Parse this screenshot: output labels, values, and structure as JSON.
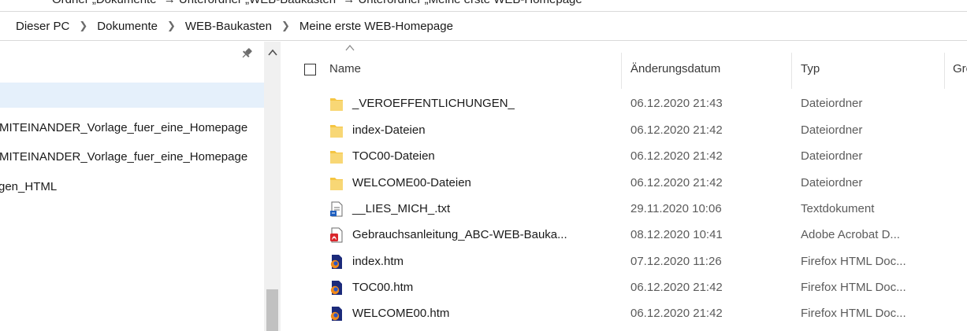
{
  "top_strip": {
    "text": "Ordner „Dokumente“ → Unterordner „WEB-Baukasten“ → Unterordner „Meine erste WEB-Homepage“"
  },
  "breadcrumb": [
    "Dieser PC",
    "Dokumente",
    "WEB-Baukasten",
    "Meine erste WEB-Homepage"
  ],
  "nav_pane": {
    "items": [
      {
        "label": "",
        "selected": true
      },
      {
        "label": "-MITEINANDER_Vorlage_fuer_eine_Homepage",
        "selected": false
      },
      {
        "label": "-MITEINANDER_Vorlage_fuer_eine_Homepage",
        "selected": false
      },
      {
        "label": "gen_HTML",
        "selected": false
      }
    ]
  },
  "columns": {
    "name": "Name",
    "date": "Änderungsdatum",
    "type": "Typ",
    "size": "Größe"
  },
  "files": [
    {
      "icon": "folder-icon",
      "name": "_VEROEFFENTLICHUNGEN_",
      "date": "06.12.2020 21:43",
      "type": "Dateiordner"
    },
    {
      "icon": "folder-icon",
      "name": "index-Dateien",
      "date": "06.12.2020 21:42",
      "type": "Dateiordner"
    },
    {
      "icon": "folder-icon",
      "name": "TOC00-Dateien",
      "date": "06.12.2020 21:42",
      "type": "Dateiordner"
    },
    {
      "icon": "folder-icon",
      "name": "WELCOME00-Dateien",
      "date": "06.12.2020 21:42",
      "type": "Dateiordner"
    },
    {
      "icon": "text-file-icon",
      "name": "__LIES_MICH_.txt",
      "date": "29.11.2020 10:06",
      "type": "Textdokument"
    },
    {
      "icon": "pdf-icon",
      "name": "Gebrauchsanleitung_ABC-WEB-Bauka...",
      "date": "08.12.2020 10:41",
      "type": "Adobe Acrobat D..."
    },
    {
      "icon": "firefox-html-icon",
      "name": "index.htm",
      "date": "07.12.2020 11:26",
      "type": "Firefox HTML Doc..."
    },
    {
      "icon": "firefox-html-icon",
      "name": "TOC00.htm",
      "date": "06.12.2020 21:42",
      "type": "Firefox HTML Doc..."
    },
    {
      "icon": "firefox-html-icon",
      "name": "WELCOME00.htm",
      "date": "06.12.2020 21:42",
      "type": "Firefox HTML Doc..."
    }
  ],
  "colors": {
    "selection": "#e5f0fb",
    "folder": "#f5c542",
    "pdf_red": "#d9262b",
    "html_navy": "#1b2a7a",
    "html_orange": "#f08a1c"
  }
}
